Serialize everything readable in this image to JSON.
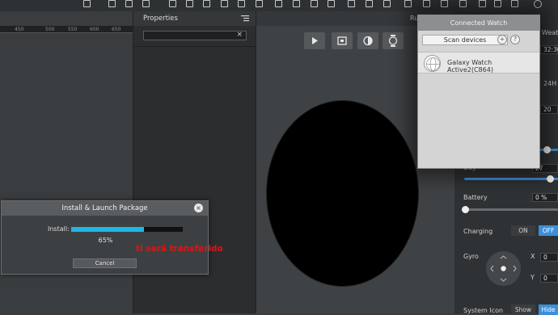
{
  "toolbar": {
    "icons": [
      "layout-icon",
      "align-left-icon",
      "align-center-icon",
      "align-right-icon",
      "align-top-icon",
      "align-middle-icon",
      "align-bottom-icon",
      "distribute-h-icon",
      "distribute-v-icon",
      "copy-icon",
      "image-icon",
      "chart-icon",
      "run-icon",
      "export-icon",
      "settings-icon",
      "theme-icon"
    ]
  },
  "ruler": {
    "ticks": [
      "450",
      "500",
      "550",
      "600",
      "650"
    ]
  },
  "properties": {
    "title": "Properties",
    "search_placeholder": "",
    "clear_label": "×"
  },
  "canvas": {
    "run_label": "Ru"
  },
  "right_panel": {
    "weather_label": "Weat",
    "time_value": "32:30",
    "hour_format": "24H",
    "number_value": "20",
    "day_value": "27",
    "battery_label": "Battery",
    "battery_value": "0 %",
    "charging_label": "Charging",
    "on_label": "ON",
    "off_label": "OFF",
    "gyro_label": "Gyro",
    "x_label": "X",
    "x_value": "0",
    "y_label": "Y",
    "y_value": "0",
    "day_label": "Day",
    "system_icon_label": "System Icon",
    "show_label": "Show",
    "hide_label": "Hide",
    "accent": "#3b8fd8"
  },
  "connected_watch": {
    "title": "Connected Watch",
    "scan_label": "Scan devices",
    "add_label": "+",
    "help_label": "?",
    "device_name": "Galaxy Watch Active2(C864)"
  },
  "install_dialog": {
    "title": "Install & Launch Package",
    "close_label": "×",
    "install_label": "Install:",
    "progress": 0.65,
    "progress_text": "65%",
    "cancel_label": "Cancel",
    "accent": "#1eb7e6"
  },
  "annotation": {
    "text": "ti será transferido",
    "color": "#e31212"
  }
}
